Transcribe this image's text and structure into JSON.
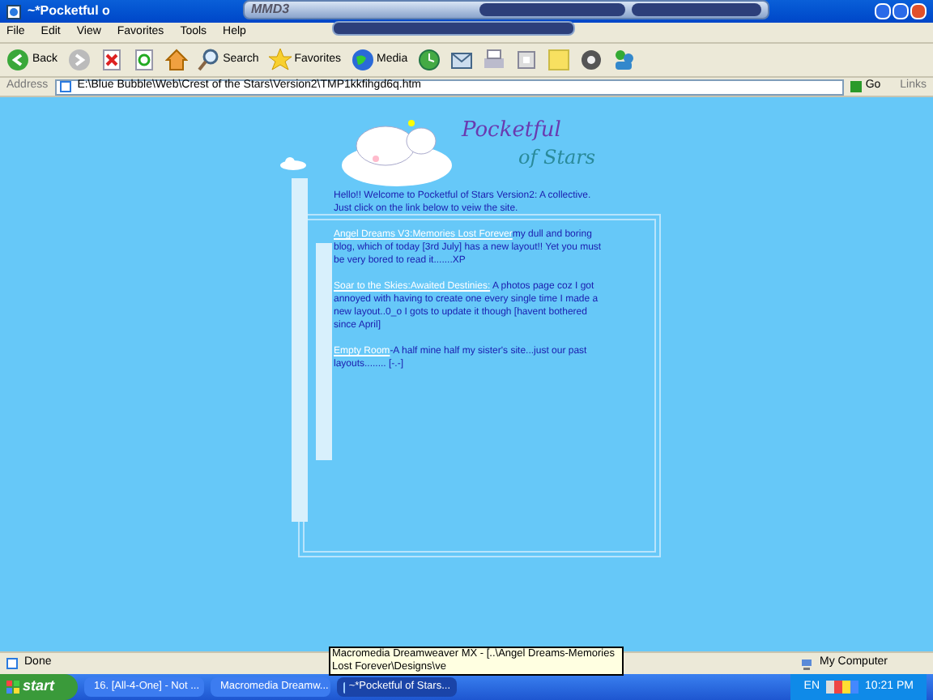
{
  "window": {
    "title": "~*Pocketful o"
  },
  "media_player": {
    "logo": "MMD3"
  },
  "menu": [
    "File",
    "Edit",
    "View",
    "Favorites",
    "Tools",
    "Help"
  ],
  "toolbar": [
    {
      "kind": "back",
      "label": "Back"
    },
    {
      "kind": "forward"
    },
    {
      "kind": "stop"
    },
    {
      "kind": "refresh"
    },
    {
      "kind": "home"
    },
    {
      "kind": "search",
      "label": "Search"
    },
    {
      "kind": "favorites",
      "label": "Favorites"
    },
    {
      "kind": "media",
      "label": "Media"
    },
    {
      "kind": "history"
    },
    {
      "kind": "mail"
    },
    {
      "kind": "print"
    },
    {
      "kind": "edit"
    },
    {
      "kind": "note"
    },
    {
      "kind": "flower"
    },
    {
      "kind": "messenger"
    }
  ],
  "address_bar": {
    "label": "Address",
    "value": "E:\\Blue Bubble\\Web\\Crest of the Stars\\Version2\\TMP1kkfihgd6q.htm",
    "go": "Go",
    "links": "Links"
  },
  "page": {
    "logo_line_1": "Pocketful",
    "logo_line_2": "of Stars",
    "intro": "Hello!! Welcome to Pocketful of Stars Version2: A collective. Just click on the link below to veiw the site.",
    "entries": [
      {
        "link": "Angel Dreams V3:Memories Lost Forever",
        "text": "my dull and boring blog, which of today [3rd July] has a new layout!! Yet you must be very bored to read it.......XP"
      },
      {
        "link": "Soar to the Skies:Awaited Destinies:",
        "text": " A photos page coz I got annoyed with having to create one every single time I made a new layout..0_o I gots to update it though [havent bothered since April]"
      },
      {
        "link": "Empty Room",
        "text": "-A half mine half my sister's site...just our past layouts........ [-.-]"
      }
    ]
  },
  "tooltip": "Macromedia Dreamweaver MX - [..\\Angel Dreams-Memories Lost Forever\\Designs\\ve",
  "status_bar": {
    "text": "Done",
    "zone": "My Computer"
  },
  "taskbar": {
    "start": "start",
    "tasks": [
      {
        "label": "16. [All-4-One] - Not ...",
        "selected": false
      },
      {
        "label": "Macromedia Dreamw...",
        "selected": false
      },
      {
        "label": "~*Pocketful of Stars...",
        "selected": true
      }
    ],
    "language": "EN",
    "clock": "10:21 PM"
  }
}
